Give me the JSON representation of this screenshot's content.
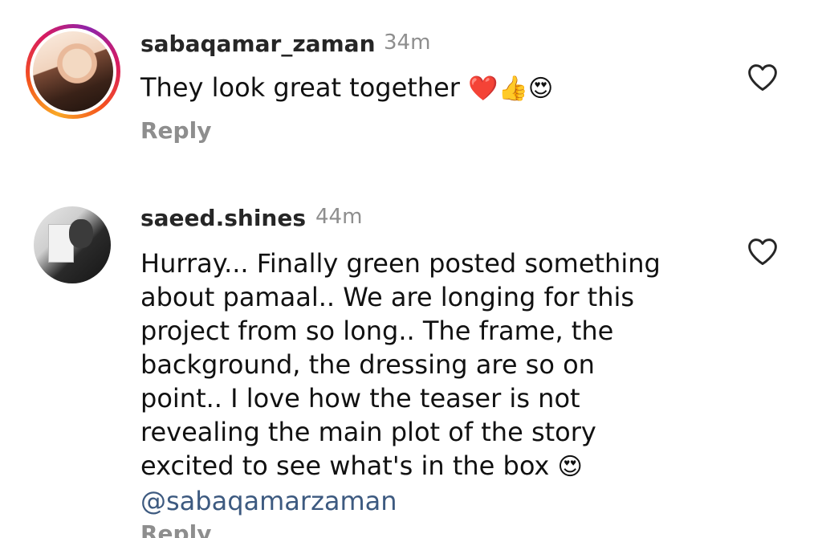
{
  "comments": [
    {
      "username": "sabaqamar_zaman",
      "time": "34m",
      "text": "They look great together",
      "emojis": [
        "❤️",
        "👍",
        "😍"
      ],
      "reply_label": "Reply"
    },
    {
      "username": "saeed.shines",
      "time": "44m",
      "lines": [
        "Hurray... Finally green posted something",
        "about pamaal.. We are longing for this",
        "project from so long.. The frame, the",
        "background, the dressing are so on",
        "point.. I love how the teaser is not",
        "revealing the main plot of the story",
        "excited to see what's in the box"
      ],
      "line_emoji": "😍",
      "mention": "@sabaqamarzaman",
      "reply_label": "Reply"
    }
  ],
  "colors": {
    "username": "#262626",
    "muted": "#8e8e8e",
    "mention": "#3d5a80",
    "story_ring": [
      "#f9a825",
      "#d81b60",
      "#8e24aa"
    ]
  },
  "icons": {
    "like": "heart-outline-icon"
  }
}
